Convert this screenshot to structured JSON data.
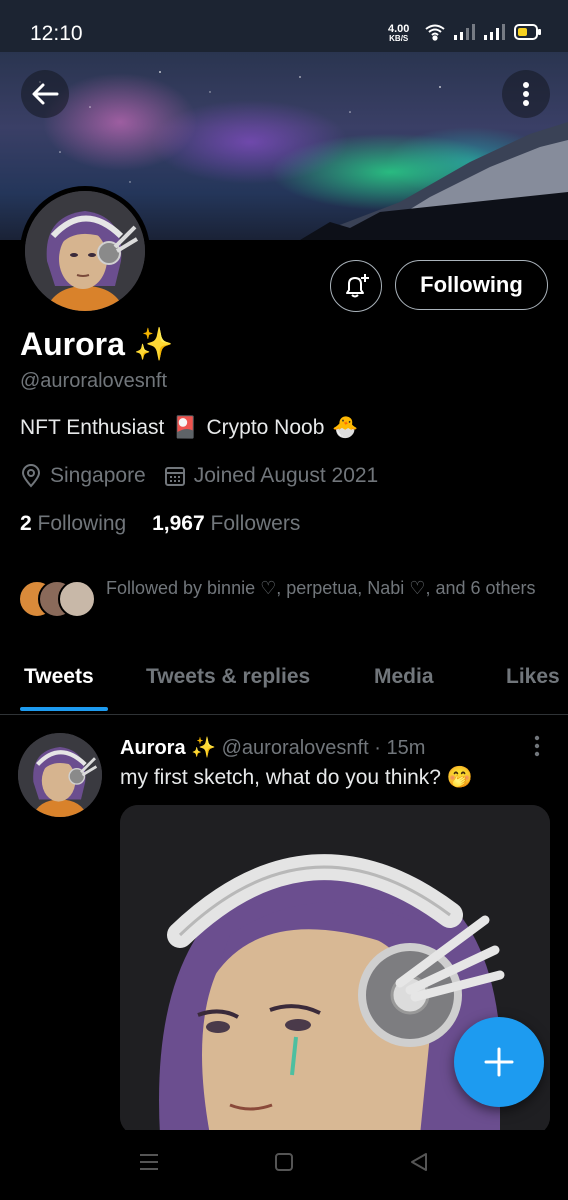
{
  "status": {
    "time": "12:10",
    "speed_value": "4.00",
    "speed_unit": "KB/S"
  },
  "profile": {
    "name": "Aurora",
    "name_emoji": "✨",
    "handle": "@auroralovesnft",
    "bio": [
      "NFT Enthusiast",
      "🎴",
      "Crypto Noob",
      "🐣"
    ],
    "location": "Singapore",
    "joined": "Joined August 2021",
    "following_count": "2",
    "following_label": "Following",
    "followers_count": "1,967",
    "followers_label": "Followers",
    "followed_by": "Followed by binnie ♡, perpetua, Nabi ♡, and 6 others",
    "follow_button": "Following"
  },
  "tabs": [
    {
      "label": "Tweets",
      "active": true
    },
    {
      "label": "Tweets & replies",
      "active": false
    },
    {
      "label": "Media",
      "active": false
    },
    {
      "label": "Likes",
      "active": false
    }
  ],
  "tweet": {
    "name": "Aurora",
    "emoji": "✨",
    "handle": "@auroralovesnft",
    "separator": "·",
    "time": "15m",
    "text": "my first sketch, what do you think?",
    "text_emoji": "🤭"
  },
  "icons": [
    "back-arrow-icon",
    "more-vertical-icon",
    "bell-plus-icon",
    "location-icon",
    "calendar-icon",
    "compose-plus-icon",
    "wifi-icon",
    "signal-icon",
    "battery-icon"
  ],
  "colors": {
    "accent": "#1d9bf0",
    "background": "#000000",
    "muted": "#71767b"
  }
}
